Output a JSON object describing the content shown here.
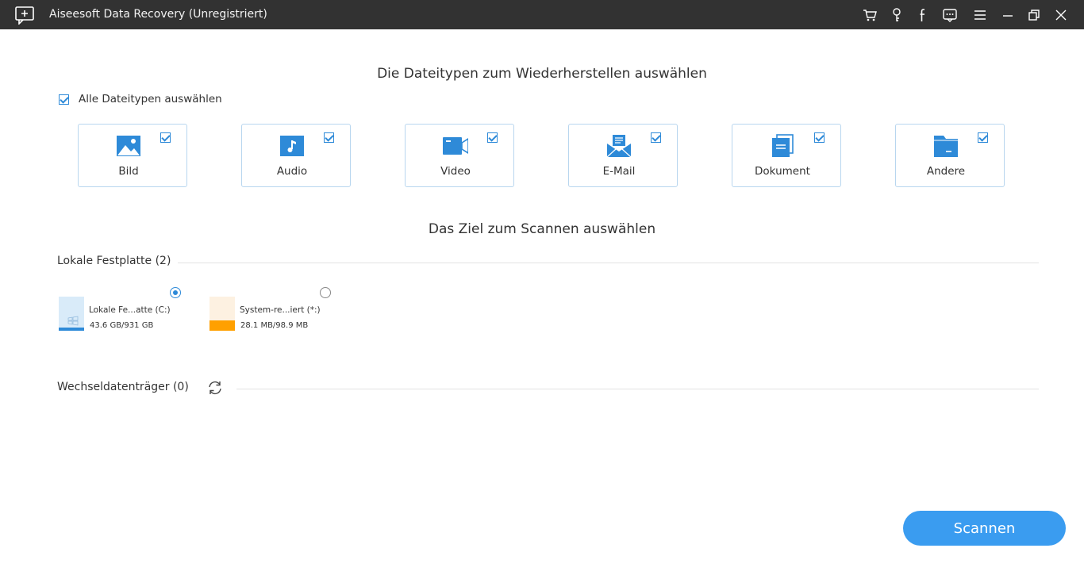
{
  "window": {
    "title": "Aiseesoft Data Recovery (Unregistriert)"
  },
  "colors": {
    "accent": "#3a9cf0",
    "titlebar": "#323232",
    "card_border": "#b8d6ef",
    "system_drive_bar": "#ffa000"
  },
  "titlebar_icons": [
    "cart-icon",
    "key-icon",
    "facebook-icon",
    "feedback-icon",
    "menu-icon",
    "minimize-icon",
    "restore-icon",
    "close-icon"
  ],
  "filetypes": {
    "heading": "Die Dateitypen zum Wiederherstellen auswählen",
    "select_all_label": "Alle Dateitypen auswählen",
    "select_all_checked": true,
    "items": [
      {
        "label": "Bild",
        "icon": "image-icon",
        "checked": true
      },
      {
        "label": "Audio",
        "icon": "music-note-icon",
        "checked": true
      },
      {
        "label": "Video",
        "icon": "video-camera-icon",
        "checked": true
      },
      {
        "label": "E-Mail",
        "icon": "envelope-icon",
        "checked": true
      },
      {
        "label": "Dokument",
        "icon": "document-icon",
        "checked": true
      },
      {
        "label": "Andere",
        "icon": "folder-icon",
        "checked": true
      }
    ]
  },
  "target": {
    "heading": "Das Ziel zum Scannen auswählen",
    "local_group": {
      "label": "Lokale Festplatte (2)",
      "drives": [
        {
          "name": "Lokale Fe...atte (C:)",
          "size": "43.6 GB/931 GB",
          "selected": true,
          "used_fraction": 0.047
        },
        {
          "name": "System-re...iert (*:)",
          "size": "28.1 MB/98.9 MB",
          "selected": false,
          "used_fraction": 0.284
        }
      ]
    },
    "removable_group": {
      "label": "Wechseldatenträger (0)"
    }
  },
  "scan_button": {
    "label": "Scannen"
  }
}
